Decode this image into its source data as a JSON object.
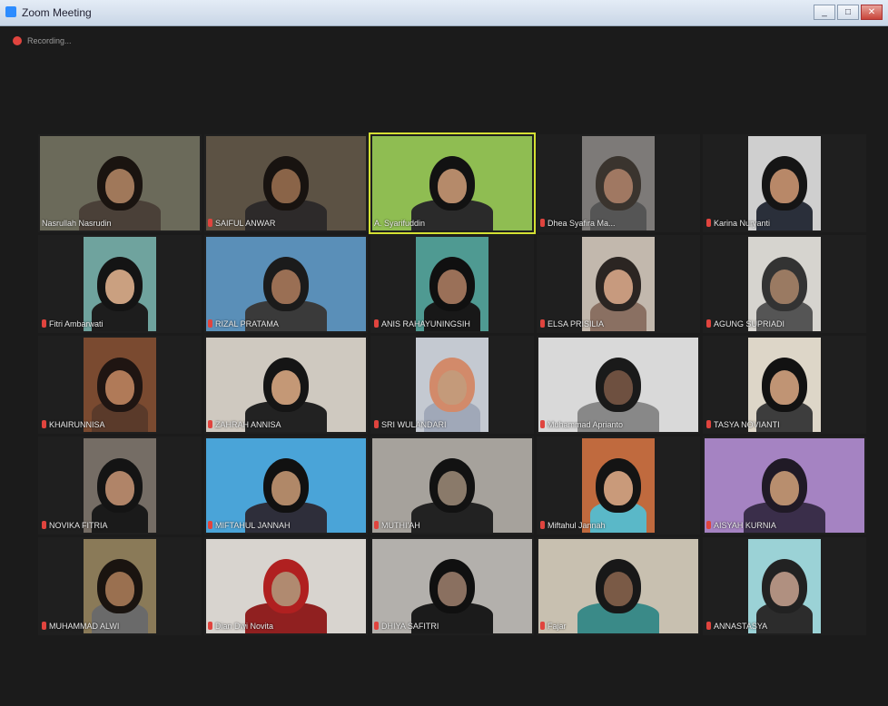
{
  "window": {
    "title": "Zoom Meeting",
    "minimize": "_",
    "maximize": "□",
    "close": "✕"
  },
  "status": {
    "recording_label": "Recording...",
    "recording_color": "#e0443e"
  },
  "participants": [
    {
      "name": "Nasrullah Nasrudin",
      "muted": false,
      "bg": "#6b6a5a",
      "skin": "#a0785a",
      "hair": "#1a1410",
      "cloth": "#4a4038"
    },
    {
      "name": "SAIFUL ANWAR",
      "muted": true,
      "bg": "#5c5244",
      "skin": "#8a6448",
      "hair": "#181310",
      "cloth": "#2d2a2a"
    },
    {
      "name": "A. Syarifuddin",
      "muted": false,
      "bg": "#8fbd52",
      "skin": "#b58a6a",
      "hair": "#121212",
      "cloth": "#2a2a2a",
      "active": true
    },
    {
      "name": "Dhea Syafira Ma...",
      "muted": true,
      "bg": "#7d7a78",
      "skin": "#a07862",
      "hair": "#3a342e",
      "cloth": "#555"
    },
    {
      "name": "Karina Nuryanti",
      "muted": true,
      "bg": "#cfcfcf",
      "skin": "#b88868",
      "hair": "#151515",
      "cloth": "#2a2f3a"
    },
    {
      "name": "Fitri Ambarwati",
      "muted": true,
      "bg": "#6fa39e",
      "skin": "#caa080",
      "hair": "#141414",
      "cloth": "#1d1d1d"
    },
    {
      "name": "RIZAL PRATAMA",
      "muted": true,
      "bg": "#5a8fb8",
      "skin": "#9a6f54",
      "hair": "#1b1b1b",
      "cloth": "#3a3a3a"
    },
    {
      "name": "ANIS RAHAYUNINGSIH",
      "muted": true,
      "bg": "#4f9a92",
      "skin": "#9a7058",
      "hair": "#101010",
      "cloth": "#181818"
    },
    {
      "name": "ELSA PRISILIA",
      "muted": true,
      "bg": "#c2b8ad",
      "skin": "#c79a7e",
      "hair": "#2b2522",
      "cloth": "#8a7062"
    },
    {
      "name": "AGUNG SUPRIADI",
      "muted": true,
      "bg": "#d6d4cf",
      "skin": "#9a7a62",
      "hair": "#333",
      "cloth": "#555"
    },
    {
      "name": "KHAIRUNNISA",
      "muted": true,
      "bg": "#7a4a30",
      "skin": "#b07a58",
      "hair": "#1f1512",
      "cloth": "#5a3a2a"
    },
    {
      "name": "ZAHRAH ANNISA",
      "muted": true,
      "bg": "#cfc9c0",
      "skin": "#c49876",
      "hair": "#151515",
      "cloth": "#222"
    },
    {
      "name": "SRI WULANDARI",
      "muted": true,
      "bg": "#c4c9d1",
      "skin": "#c49a7a",
      "hair": "#d28a6a",
      "cloth": "#a0a8b8"
    },
    {
      "name": "Muhammad Aprianto",
      "muted": true,
      "bg": "#d9d9d9",
      "skin": "#6e5040",
      "hair": "#1a1a1a",
      "cloth": "#888"
    },
    {
      "name": "TASYA NOVIANTI",
      "muted": true,
      "bg": "#ddd6c8",
      "skin": "#c09474",
      "hair": "#121212",
      "cloth": "#3d3d3d"
    },
    {
      "name": "NOVIKA FITRIA",
      "muted": true,
      "bg": "#756d65",
      "skin": "#b08468",
      "hair": "#141414",
      "cloth": "#1a1a1a"
    },
    {
      "name": "MIFTAHUL JANNAH",
      "muted": true,
      "bg": "#4aa4d8",
      "skin": "#b08868",
      "hair": "#111",
      "cloth": "#2e2e3a"
    },
    {
      "name": "MUTHI'AH",
      "muted": true,
      "bg": "#a6a29c",
      "skin": "#8a7a6a",
      "hair": "#121212",
      "cloth": "#222"
    },
    {
      "name": "Miftahul Jannah",
      "muted": true,
      "bg": "#c06a3e",
      "skin": "#c99a7a",
      "hair": "#141414",
      "cloth": "#5ab8c8"
    },
    {
      "name": "AISYAH KURNIA",
      "muted": true,
      "bg": "#a583c2",
      "skin": "#b88e6e",
      "hair": "#201a26",
      "cloth": "#3a2e4a"
    },
    {
      "name": "MUHAMMAD ALWI",
      "muted": true,
      "bg": "#8a7a58",
      "skin": "#9a7050",
      "hair": "#1a1410",
      "cloth": "#6a6a6a"
    },
    {
      "name": "Dian Dwi Novita",
      "muted": true,
      "bg": "#d8d4cf",
      "skin": "#b08a70",
      "hair": "#b02020",
      "cloth": "#902020"
    },
    {
      "name": "DHIYA SAFITRI",
      "muted": true,
      "bg": "#b3b0ac",
      "skin": "#8a7060",
      "hair": "#101010",
      "cloth": "#1b1b1b"
    },
    {
      "name": "Fajar",
      "muted": true,
      "bg": "#c8c0b0",
      "skin": "#7a5a46",
      "hair": "#181818",
      "cloth": "#3a8a88"
    },
    {
      "name": "ANNASTASYA",
      "muted": true,
      "bg": "#9bd2d6",
      "skin": "#b09080",
      "hair": "#222",
      "cloth": "#2c2c2c"
    }
  ]
}
